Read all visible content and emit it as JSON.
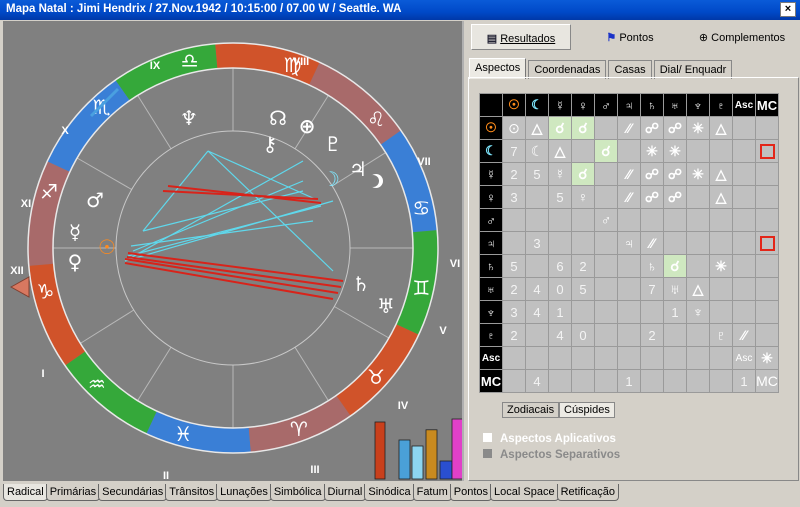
{
  "window": {
    "title": "Mapa Natal :  Jimi Hendrix  /  27.Nov.1942  /  10:15:00  /  07.00 W  /  Seattle. WA",
    "close": "×"
  },
  "top_buttons": [
    {
      "label": "Resultados",
      "icon": "results-icon"
    },
    {
      "label": "Pontos",
      "icon": "points-icon"
    },
    {
      "label": "Complementos",
      "icon": "plus-circle-icon"
    }
  ],
  "tabs": [
    "Aspectos",
    "Coordenadas",
    "Casas",
    "Dial/ Enquadr"
  ],
  "house_numerals": [
    "I",
    "II",
    "III",
    "IV",
    "V",
    "VI",
    "VII",
    "VIII",
    "IX",
    "X",
    "XI",
    "XII"
  ],
  "zodiac_signs": [
    "♈",
    "♉",
    "♊",
    "♋",
    "♌",
    "♍",
    "♎",
    "♏",
    "♐",
    "♑",
    "♒",
    "♓"
  ],
  "planet_glyphs": [
    "☉",
    "☽",
    "☿",
    "♀",
    "♂",
    "♃",
    "♄",
    "♅",
    "♆",
    "♇",
    "☊",
    "⊕",
    "⚷"
  ],
  "grid": {
    "header": [
      "☉",
      "☾",
      "☿",
      "♀",
      "♂",
      "♃",
      "♄",
      "♅",
      "♆",
      "♇",
      "Asc",
      "MC"
    ],
    "rows": [
      [
        "☉",
        "⊙",
        "△",
        "☌",
        "☌",
        "",
        "⁄⁄",
        "☍",
        "☍",
        "✳",
        "△",
        "",
        ""
      ],
      [
        "☾",
        "7",
        "☾",
        "△",
        "",
        "☌",
        "",
        "✳",
        "✳",
        "",
        "",
        "",
        "□"
      ],
      [
        "☿",
        "2",
        "5",
        "☿",
        "☌",
        "",
        "⁄⁄",
        "☍",
        "☍",
        "✳",
        "△",
        "",
        ""
      ],
      [
        "♀",
        "3",
        "",
        "5",
        "♀",
        "",
        "⁄⁄",
        "☍",
        "☍",
        "",
        "△",
        "",
        ""
      ],
      [
        "♂",
        "",
        "",
        "",
        "",
        "♂",
        "",
        "",
        "",
        "",
        "",
        "",
        ""
      ],
      [
        "♃",
        "",
        "3",
        "",
        "",
        "",
        "♃",
        "⁄⁄",
        "",
        "",
        "",
        "",
        "□"
      ],
      [
        "♄",
        "5",
        "",
        "6",
        "2",
        "",
        "",
        "♄",
        "☌",
        "",
        "✳",
        "",
        ""
      ],
      [
        "♅",
        "2",
        "4",
        "0",
        "5",
        "",
        "",
        "7",
        "♅",
        "△",
        "",
        "",
        ""
      ],
      [
        "♆",
        "3",
        "4",
        "1",
        "",
        "",
        "",
        "",
        "1",
        "♆",
        "",
        "",
        ""
      ],
      [
        "♇",
        "2",
        "",
        "4",
        "0",
        "",
        "",
        "2",
        "",
        "",
        "♇",
        "⁄⁄",
        ""
      ],
      [
        "Asc",
        "",
        "",
        "",
        "",
        "",
        "",
        "",
        "",
        "",
        "",
        "Asc",
        "✳"
      ],
      [
        "MC",
        "",
        "4",
        "",
        "",
        "",
        "1",
        "",
        "",
        "",
        "",
        "1",
        "MC"
      ]
    ]
  },
  "grid_tabs": [
    "Zodiacais",
    "Cúspides"
  ],
  "legend": [
    "Aspectos Aplicativos",
    "Aspectos Separativos"
  ],
  "bottom_tabs": [
    "Radical",
    "Primárias",
    "Secundárias",
    "Trânsitos",
    "Lunações",
    "Simbólica",
    "Diurnal",
    "Sinódica",
    "Fatum",
    "Pontos",
    "Local Space",
    "Retificação"
  ],
  "bars": [
    {
      "color": "#c9401c",
      "level": 0.95
    },
    {
      "color": "#4aa0d8",
      "level": 0.65
    },
    {
      "color": "#8dd5f0",
      "level": 0.55
    },
    {
      "color": "#c98a1f",
      "level": 0.82
    },
    {
      "color": "#2a4fd0",
      "level": 0.3
    },
    {
      "color": "#e040c8",
      "level": 1.0
    }
  ]
}
